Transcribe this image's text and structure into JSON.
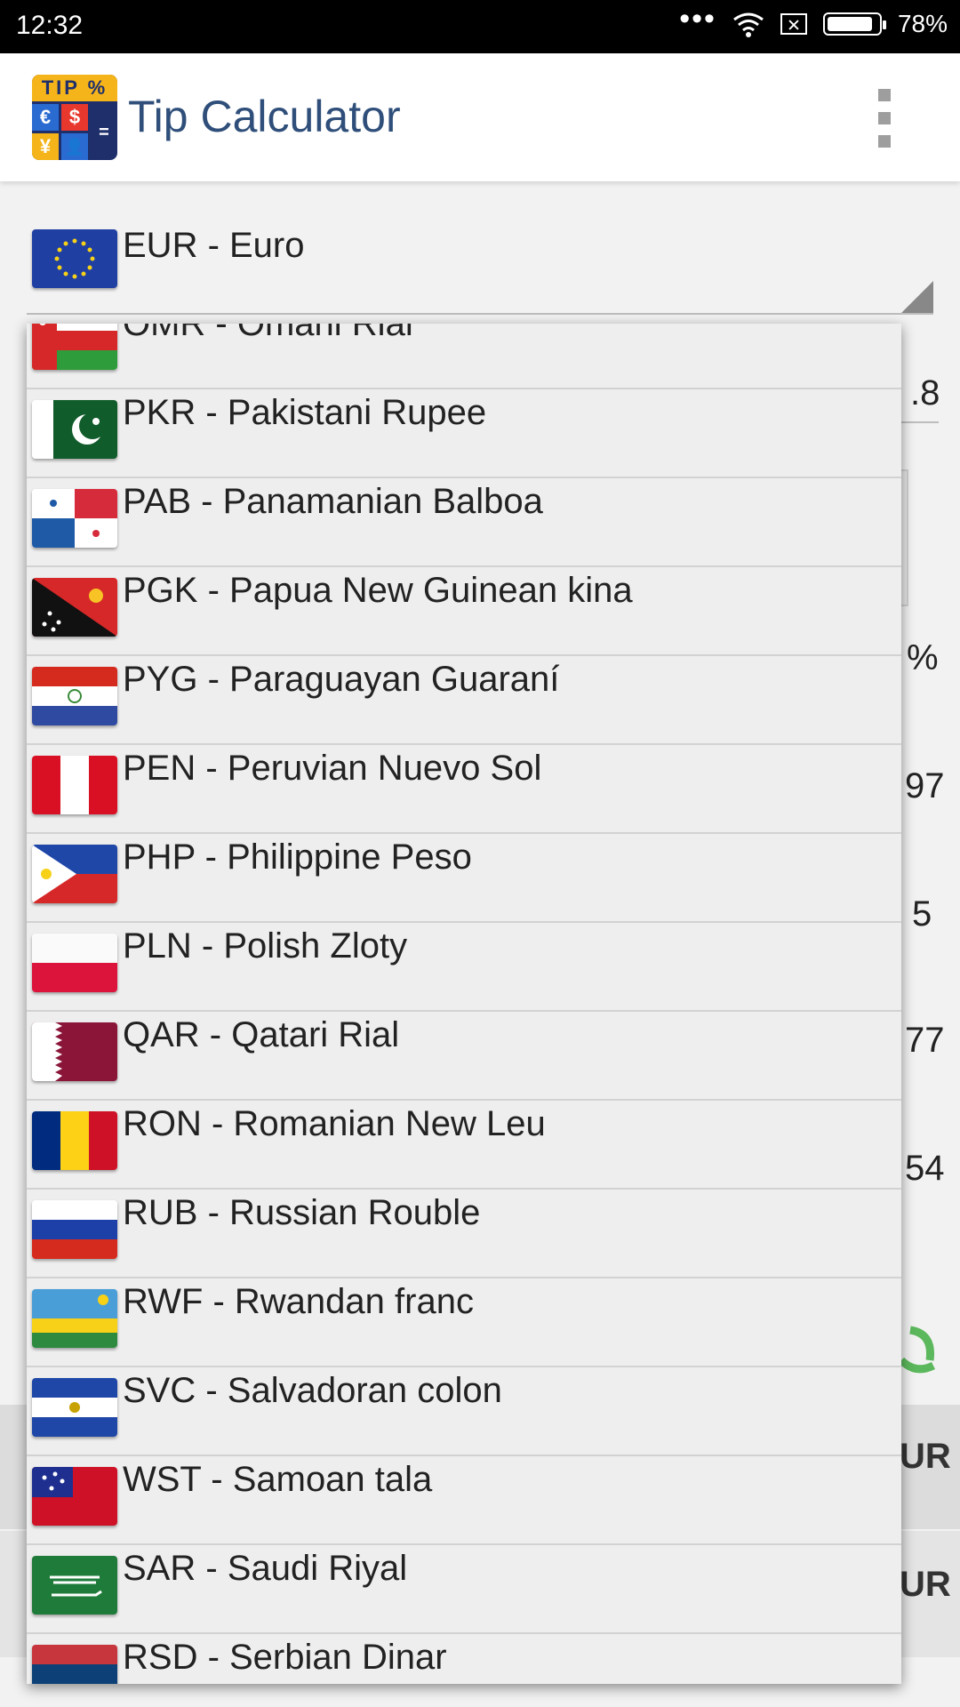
{
  "status_bar": {
    "time": "12:32",
    "battery": "78%"
  },
  "app": {
    "title": "Tip Calculator",
    "logo": {
      "banner": "TIP %",
      "symbols": [
        "€",
        "$",
        "¥",
        "="
      ]
    }
  },
  "spinner": {
    "selected_label": "EUR - Euro",
    "flag": "eu-flag"
  },
  "background_fragments": [
    ".8",
    "%",
    "97",
    "5",
    "77",
    "54",
    "UR",
    "UR"
  ],
  "dropdown": {
    "items": [
      {
        "label": "OMR - Omani Rial",
        "flag": "oman-flag"
      },
      {
        "label": "PKR - Pakistani Rupee",
        "flag": "pakistan-flag"
      },
      {
        "label": "PAB - Panamanian Balboa",
        "flag": "panama-flag"
      },
      {
        "label": "PGK - Papua New Guinean kina",
        "flag": "papua-new-guinea-flag"
      },
      {
        "label": "PYG - Paraguayan Guaraní",
        "flag": "paraguay-flag"
      },
      {
        "label": "PEN - Peruvian Nuevo Sol",
        "flag": "peru-flag"
      },
      {
        "label": "PHP - Philippine Peso",
        "flag": "philippines-flag"
      },
      {
        "label": "PLN - Polish Zloty",
        "flag": "poland-flag"
      },
      {
        "label": "QAR - Qatari Rial",
        "flag": "qatar-flag"
      },
      {
        "label": "RON - Romanian New Leu",
        "flag": "romania-flag"
      },
      {
        "label": "RUB - Russian Rouble",
        "flag": "russia-flag"
      },
      {
        "label": "RWF - Rwandan franc",
        "flag": "rwanda-flag"
      },
      {
        "label": "SVC - Salvadoran colon",
        "flag": "el-salvador-flag"
      },
      {
        "label": "WST - Samoan tala",
        "flag": "samoa-flag"
      },
      {
        "label": "SAR - Saudi Riyal",
        "flag": "saudi-arabia-flag"
      },
      {
        "label": "RSD - Serbian Dinar",
        "flag": "serbia-flag"
      }
    ]
  },
  "colors": {
    "title": "#2f4f7a",
    "dropdown_bg": "#eeeeee",
    "status_bar": "#000000"
  }
}
